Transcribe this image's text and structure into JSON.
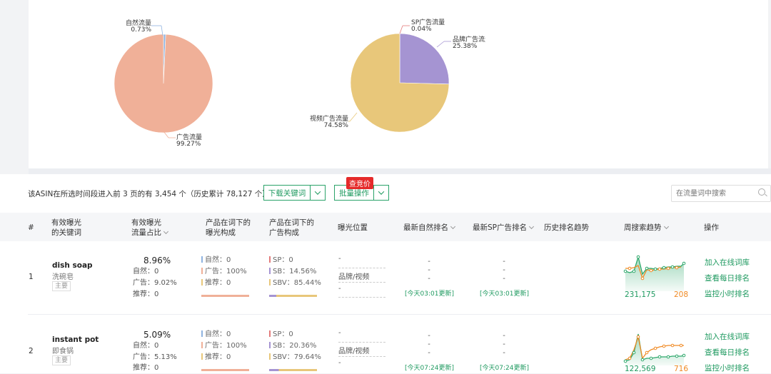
{
  "pie1": {
    "slices": [
      {
        "label": "自然流量",
        "value": "0.73%",
        "pct": 0.73,
        "color": "#8fb3e0"
      },
      {
        "label": "广告流量",
        "value": "99.27%",
        "pct": 99.27,
        "color": "#f0b098"
      }
    ]
  },
  "pie2": {
    "slices": [
      {
        "label": "SP广告流量",
        "value": "0.04%",
        "pct": 0.04,
        "color": "#e37b7b"
      },
      {
        "label": "品牌广告流量",
        "value": "25.38%",
        "pct": 25.38,
        "color": "#a594d2"
      },
      {
        "label": "视频广告流量",
        "value": "74.58%",
        "pct": 74.58,
        "color": "#e8c77a"
      }
    ]
  },
  "toolbar": {
    "summary": "该ASIN在所选时间段进入前 3 页的有 3,454 个（历史累计 78,127 个）",
    "download_label": "下载关键词",
    "batch_label": "批量操作",
    "badge": "查竞价",
    "search_placeholder": "在流量词中搜索"
  },
  "columns": {
    "index": "#",
    "keyword_1": "有效曝光",
    "keyword_2": "的关键词",
    "share_1": "有效曝光",
    "share_2": "流量占比",
    "exposure_1": "产品在词下的",
    "exposure_2": "曝光构成",
    "ad_1": "产品在词下的",
    "ad_2": "广告构成",
    "position": "曝光位置",
    "organic_rank": "最新自然排名",
    "sp_rank": "最新SP广告排名",
    "history": "历史排名趋势",
    "weekly": "周搜索趋势",
    "actions": "操作"
  },
  "rows": [
    {
      "index": "1",
      "keyword": "dish soap",
      "keyword_cn": "洗碗皂",
      "tag": "主要",
      "share": "8.96%",
      "share_organic": "自然：0",
      "share_ad": "广告：9.02%",
      "share_rec": "推荐：0",
      "exp_organic": "自然：0",
      "exp_ad": "广告：100%",
      "exp_rec": "推荐：0",
      "ad_sp": "SP：0",
      "ad_sb": "SB：14.56%",
      "ad_sbv": "SBV：85.44%",
      "ad_sb_frac": 0.1456,
      "pos_top": "-",
      "pos_mid": "品牌/视频",
      "pos_bot": "-",
      "organic_rank": [
        "-",
        "-",
        "-"
      ],
      "organic_update": "[今天03:01更新]",
      "sp_rank": [
        "-",
        "-",
        "-"
      ],
      "sp_update": "[今天03:01更新]",
      "weekly_green": "231,175",
      "weekly_orange": "208",
      "actions": [
        "加入在线词库",
        "查看每日排名",
        "监控小时排名"
      ]
    },
    {
      "index": "2",
      "keyword": "instant pot",
      "keyword_cn": "即食锅",
      "tag": "主要",
      "share": "5.09%",
      "share_organic": "自然：0",
      "share_ad": "广告：5.13%",
      "share_rec": "推荐：0",
      "exp_organic": "自然：0",
      "exp_ad": "广告：100%",
      "exp_rec": "推荐：0",
      "ad_sp": "SP：0",
      "ad_sb": "SB：20.36%",
      "ad_sbv": "SBV：79.64%",
      "ad_sb_frac": 0.2036,
      "pos_top": "-",
      "pos_mid": "品牌/视频",
      "pos_bot": "-",
      "organic_rank": [
        "-",
        "-",
        "-"
      ],
      "organic_update": "[今天07:24更新]",
      "sp_rank": [
        "-",
        "-",
        "-"
      ],
      "sp_update": "[今天07:24更新]",
      "weekly_green": "122,569",
      "weekly_orange": "716",
      "actions": [
        "加入在线词库",
        "查看每日排名",
        "监控小时排名"
      ]
    }
  ],
  "colors": {
    "accent": "#1f9a60",
    "orange": "#f08a24",
    "green_line": "#2ea86b"
  }
}
